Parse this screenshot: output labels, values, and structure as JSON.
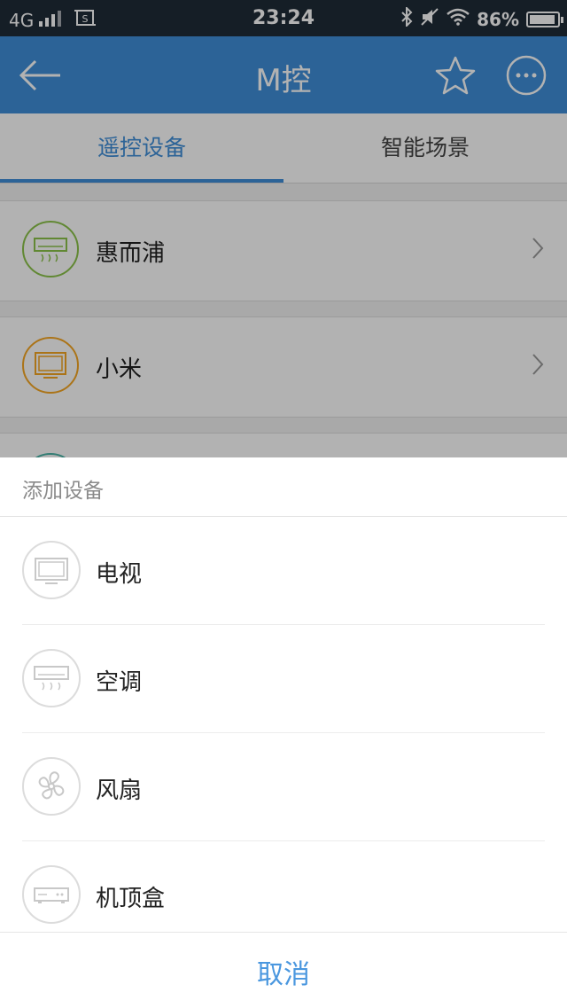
{
  "status_bar": {
    "network": "4G",
    "time": "23:24",
    "battery": "86%"
  },
  "header": {
    "title": "M控",
    "back_icon": "arrow-left-icon",
    "favorite_icon": "star-icon",
    "more_icon": "more-icon"
  },
  "tabs": [
    {
      "label": "遥控设备",
      "active": true
    },
    {
      "label": "智能场景",
      "active": false
    }
  ],
  "devices": [
    {
      "label": "惠而浦",
      "icon": "air-conditioner-icon",
      "color": "#8bc34a"
    },
    {
      "label": "小米",
      "icon": "tv-icon",
      "color": "#f5a623"
    }
  ],
  "sheet": {
    "title": "添加设备",
    "options": [
      {
        "label": "电视",
        "icon": "tv-icon"
      },
      {
        "label": "空调",
        "icon": "air-conditioner-icon"
      },
      {
        "label": "风扇",
        "icon": "fan-icon"
      },
      {
        "label": "机顶盒",
        "icon": "set-top-box-icon"
      }
    ],
    "cancel_label": "取消"
  },
  "colors": {
    "primary": "#3f8fd9",
    "status_bar": "#1f2b37",
    "cancel": "#4a97df"
  }
}
